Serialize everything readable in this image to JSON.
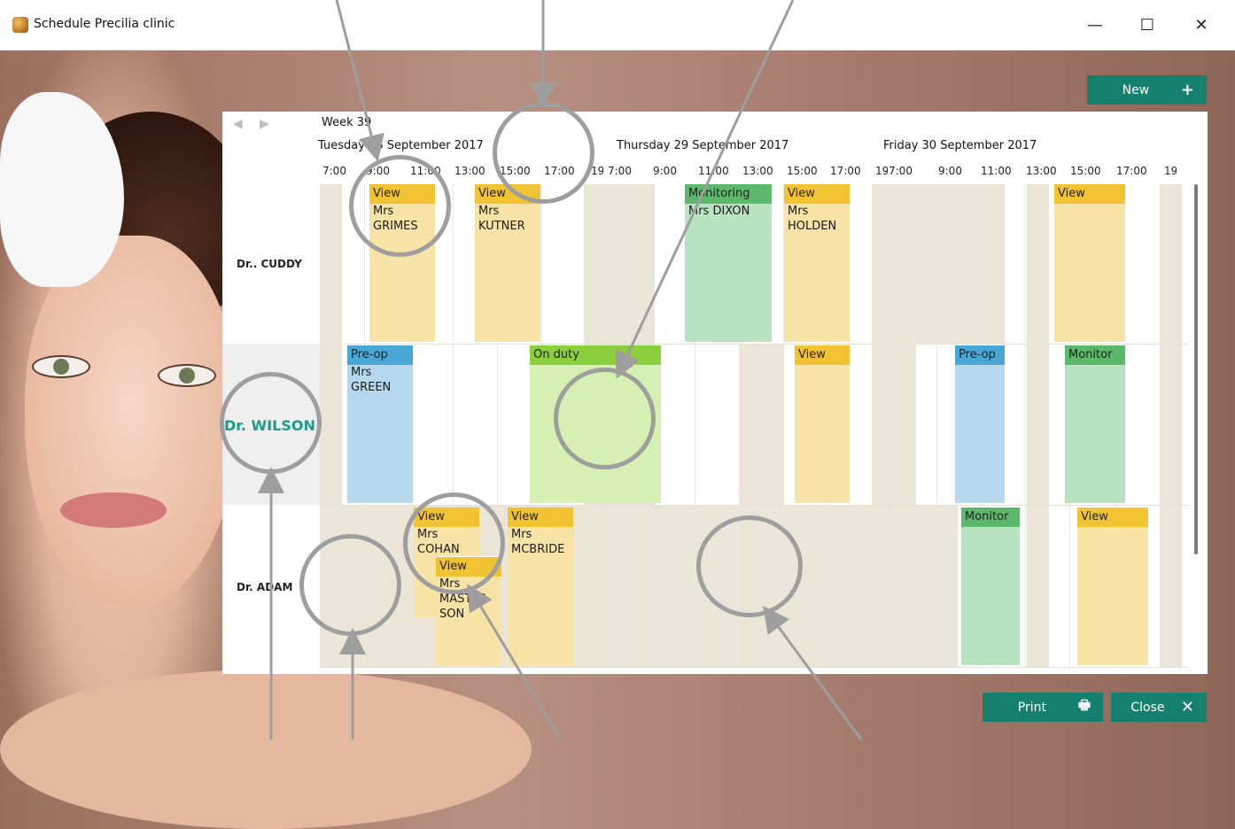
{
  "window": {
    "title": "Schedule Precilia clinic",
    "minimize": "—",
    "maximize": "☐",
    "close": "✕"
  },
  "toolbar": {
    "new_label": "New",
    "new_icon": "+",
    "print_label": "Print",
    "print_icon": "🖶",
    "close_label": "Close",
    "close_icon": "✕"
  },
  "scheduler": {
    "week": "Week 39",
    "prev": "◀",
    "next": "▶",
    "days": [
      "Tuesday 26 September 2017",
      "Thursday 29 September 2017",
      "Friday 30 September 2017"
    ],
    "times": [
      "7:00",
      "9:00",
      "11:00",
      "13:00",
      "15:00",
      "17:00",
      "19:00",
      "7:00",
      "9:00",
      "11:00",
      "13:00",
      "15:00",
      "17:00",
      "19:00",
      "7:00",
      "9:00",
      "11:00",
      "13:00",
      "15:00",
      "17:00",
      "19:00"
    ],
    "resources": [
      "Dr.. CUDDY",
      "Dr. WILSON",
      "Dr. ADAM"
    ],
    "appointments": [
      {
        "label": "View",
        "client": "Mrs GRIMES"
      },
      {
        "label": "View",
        "client": "Mrs KUTNER"
      },
      {
        "label": "Monitoring",
        "client": "Mrs DIXON"
      },
      {
        "label": "View",
        "client": "Mrs HOLDEN"
      },
      {
        "label": "View",
        "client": ""
      },
      {
        "label": "Pre-op",
        "client": "Mrs GREEN"
      },
      {
        "label": "On duty",
        "client": ""
      },
      {
        "label": "View",
        "client": ""
      },
      {
        "label": "Pre-op",
        "client": ""
      },
      {
        "label": "Monitor",
        "client": ""
      },
      {
        "label": "View",
        "client": "Mrs COHAN"
      },
      {
        "label": "View",
        "client": "Mrs MASTER-SON"
      },
      {
        "label": "View",
        "client": "Mrs MCBRIDE"
      },
      {
        "label": "Monitor",
        "client": ""
      },
      {
        "label": "View",
        "client": ""
      }
    ]
  },
  "colors": {
    "accent": "#15806e",
    "view": "#f1c231",
    "monitoring": "#5cb86a",
    "preop": "#49a7d6",
    "onduty": "#8bcf3d"
  }
}
